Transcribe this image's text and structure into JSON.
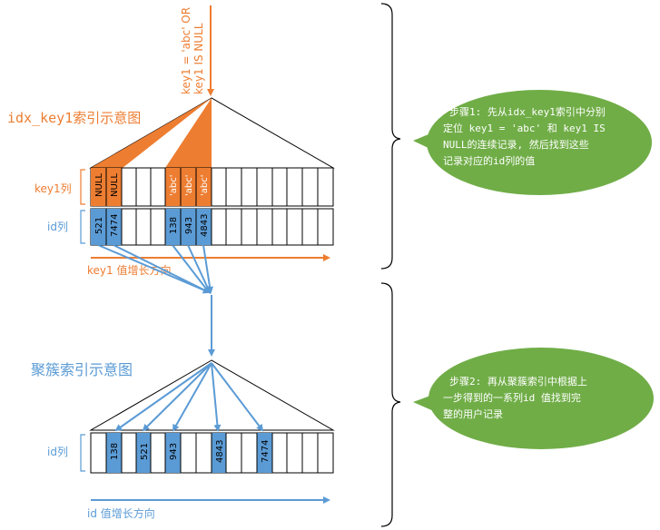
{
  "query_condition": {
    "line1": "key1 = 'abc' OR",
    "line2": "key1 IS NULL"
  },
  "secondary_index": {
    "title": "idx_key1索引示意图",
    "row_key_label": "key1列",
    "row_id_label": "id列",
    "key_values": [
      "NULL",
      "NULL",
      "'abc'",
      "'abc'",
      "'abc'"
    ],
    "id_values": [
      "521",
      "7474",
      "138",
      "943",
      "4843"
    ],
    "direction_label": "key1 值增长方向"
  },
  "clustered_index": {
    "title": "聚簇索引示意图",
    "row_id_label": "id列",
    "id_values": [
      "138",
      "521",
      "943",
      "4843",
      "7474"
    ],
    "direction_label": "id 值增长方向"
  },
  "steps": [
    {
      "lines": [
        "步骤1: 先从idx_key1索引中分别",
        "定位 key1 = 'abc' 和 key1 IS",
        "NULL的连续记录, 然后找到这些",
        "记录对应的id列的值"
      ]
    },
    {
      "lines": [
        "步骤2: 再从聚簇索引中根据上",
        "一步得到的一系列id 值找到完",
        "整的用户记录"
      ]
    }
  ],
  "colors": {
    "orange": "#ED7D31",
    "blue": "#5B9BD5",
    "green": "#70AD47",
    "black": "#000000"
  }
}
